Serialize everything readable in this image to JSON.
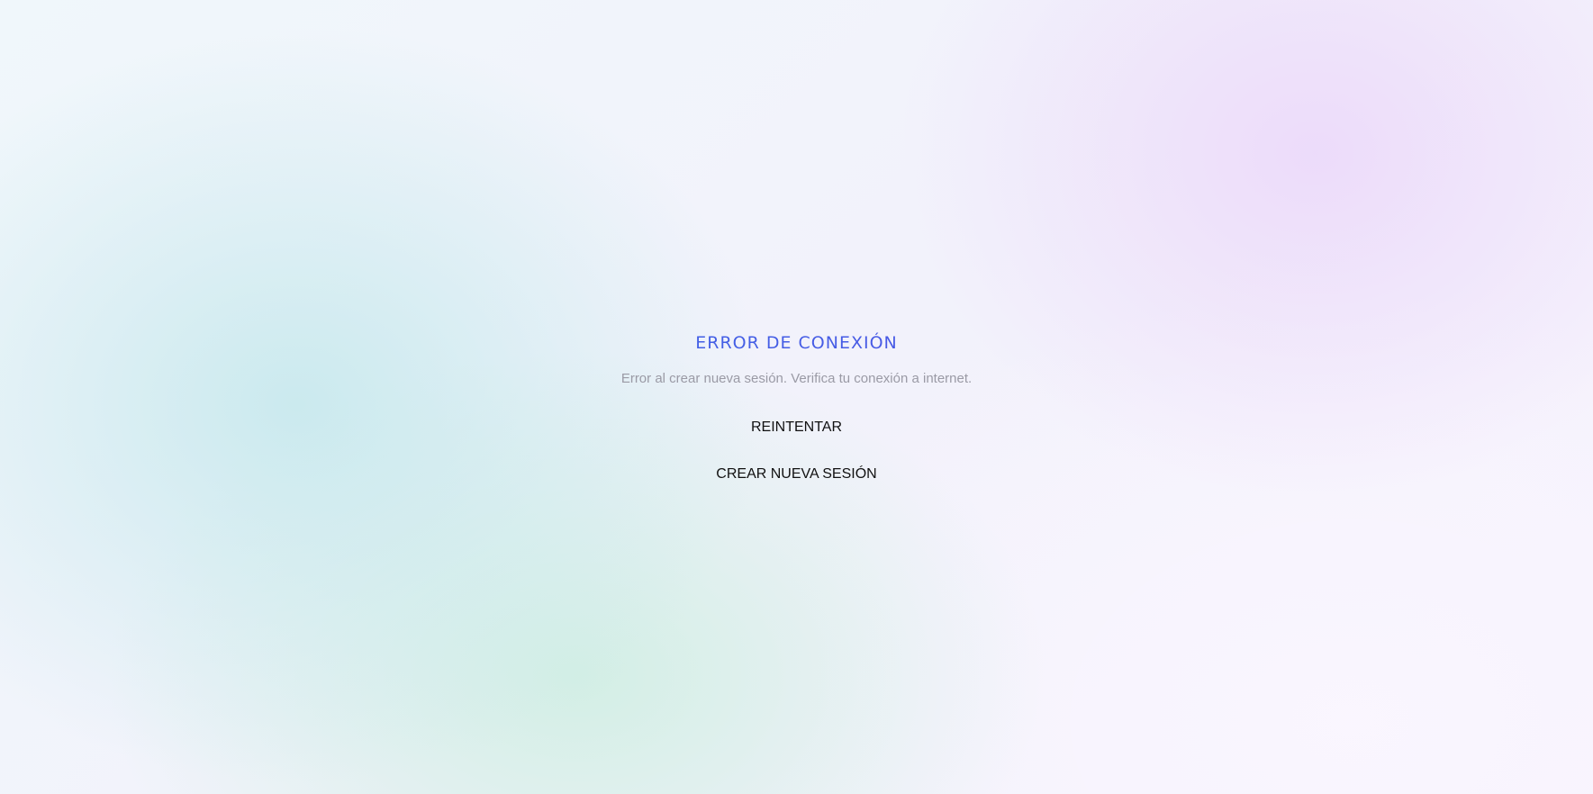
{
  "error": {
    "title": "ERROR DE CONEXIÓN",
    "message": "Error al crear nueva sesión. Verifica tu conexión a internet.",
    "retry_label": "REINTENTAR",
    "new_session_label": "CREAR NUEVA SESIÓN"
  },
  "colors": {
    "title_gradient_start": "#2f6fe4",
    "title_gradient_end": "#5b4ae6",
    "message_text": "#9a9aa5",
    "button_text": "#111111"
  }
}
